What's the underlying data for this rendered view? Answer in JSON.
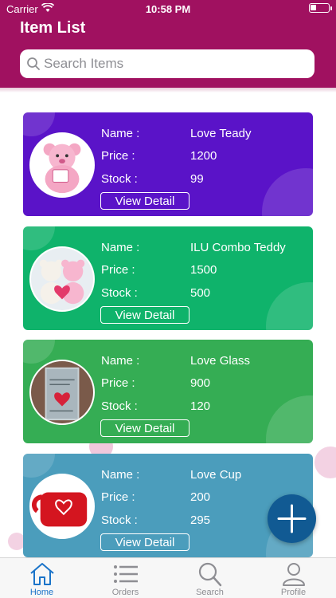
{
  "status_bar": {
    "carrier": "Carrier",
    "time": "10:58 PM"
  },
  "header": {
    "title": "Item List"
  },
  "search": {
    "placeholder": "Search Items"
  },
  "labels": {
    "name": "Name :",
    "price": "Price :",
    "stock": "Stock :",
    "view_detail": "View Detail"
  },
  "items": [
    {
      "name": "Love Teady",
      "price": "1200",
      "stock": "99",
      "color": "#5a13c8"
    },
    {
      "name": "ILU Combo Teddy",
      "price": "1500",
      "stock": "500",
      "color": "#0fb36b"
    },
    {
      "name": "Love Glass",
      "price": "900",
      "stock": "120",
      "color": "#35ad54"
    },
    {
      "name": "Love Cup",
      "price": "200",
      "stock": "295",
      "color": "#4b9dbc"
    }
  ],
  "tabs": [
    {
      "label": "Home",
      "icon": "home-icon",
      "active": true
    },
    {
      "label": "Orders",
      "icon": "list-icon",
      "active": false
    },
    {
      "label": "Search",
      "icon": "search-icon",
      "active": false
    },
    {
      "label": "Profile",
      "icon": "user-icon",
      "active": false
    }
  ],
  "colors": {
    "header": "#a01160",
    "fab": "#115a93",
    "tab_active": "#1a73c9",
    "tab_inactive": "#8e8e93"
  }
}
